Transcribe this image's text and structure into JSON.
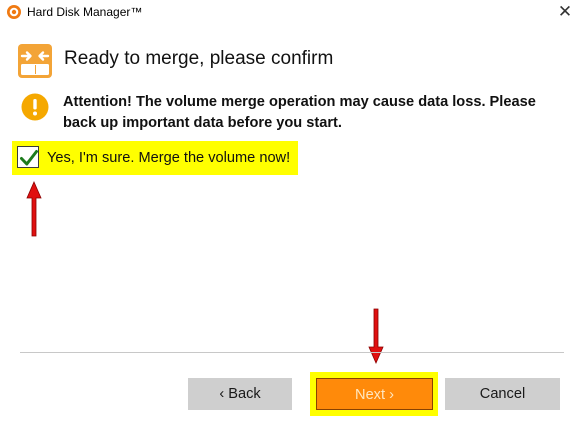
{
  "window": {
    "title": "Hard Disk Manager™",
    "close_glyph": "✕",
    "app_icon": "hdm-logo-icon"
  },
  "header": {
    "title": "Ready to merge, please confirm",
    "icon": "merge-icon"
  },
  "warning": {
    "icon": "warning-icon",
    "text": "Attention! The volume merge operation may cause data loss. Please back up important data before you start."
  },
  "confirm": {
    "label": "Yes, I'm sure. Merge the volume now!",
    "checked": true
  },
  "buttons": {
    "back": "‹ Back",
    "next": "Next ›",
    "cancel": "Cancel"
  },
  "colors": {
    "accent": "#ff8a0a",
    "highlight": "#ffff00",
    "annotation": "#e01010",
    "check": "#1d7b1d",
    "warning": "#f5a800"
  }
}
